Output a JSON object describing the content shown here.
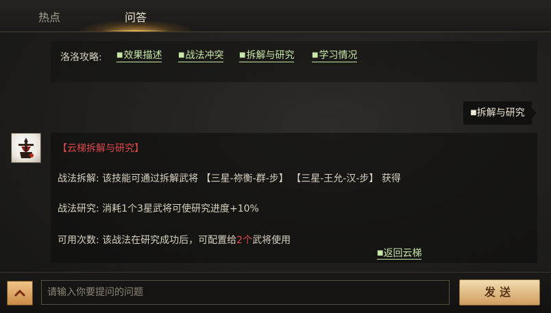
{
  "tabs": {
    "hot": "热点",
    "qa": "问答"
  },
  "guide": {
    "label": "洛洛攻略:",
    "links": [
      "效果描述",
      "战法冲突",
      "拆解与研究",
      "学习情况"
    ]
  },
  "user_message": "拆解与研究",
  "answer": {
    "title": "【云梯拆解与研究】",
    "line1": "战法拆解: 该技能可通过拆解武将 【三星-祢衡-群-步】 【三星-王允-汉-步】 获得",
    "line2": "战法研究: 消耗1个3星武将可使研究进度+10%",
    "line3_prefix": "可用次数: 该战法在研究成功后，可配置给",
    "line3_count": "2个",
    "line3_suffix": "武将使用",
    "back_link": "返回云梯"
  },
  "input": {
    "placeholder": "请输入你要提问的问题"
  },
  "send_label": "发送",
  "icons": {
    "up": "chevron-up-icon",
    "square": "square-bullet-icon",
    "avatar": "general-avatar-icon"
  },
  "colors": {
    "link": "#c8e6a8",
    "highlight": "#e0484a",
    "accent": "#e2b25a"
  }
}
